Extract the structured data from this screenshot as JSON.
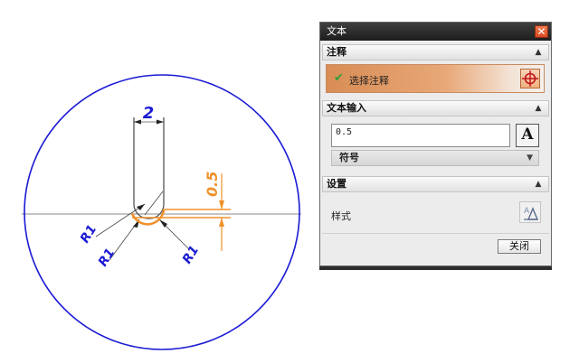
{
  "drawing": {
    "dimension_width": "2",
    "dimension_height": "0.5",
    "radius_labels": [
      "R1",
      "R1",
      "R1"
    ]
  },
  "dialog": {
    "title": "文本",
    "close_icon": "close-x-icon",
    "section_annotation": {
      "label": "注释",
      "select_label": "选择注释"
    },
    "section_text_input": {
      "label": "文本输入",
      "value": "0.5",
      "font_button_label": "A",
      "symbol_label": "符号"
    },
    "section_settings": {
      "label": "设置",
      "style_label": "样式"
    },
    "close_button_label": "关闭"
  },
  "colors": {
    "circle": "#1a1ad4",
    "dimension_blue": "#1a1ad4",
    "highlight_orange": "#f0902a",
    "profile": "#555555",
    "dialog_title": "#1d1d1d"
  }
}
